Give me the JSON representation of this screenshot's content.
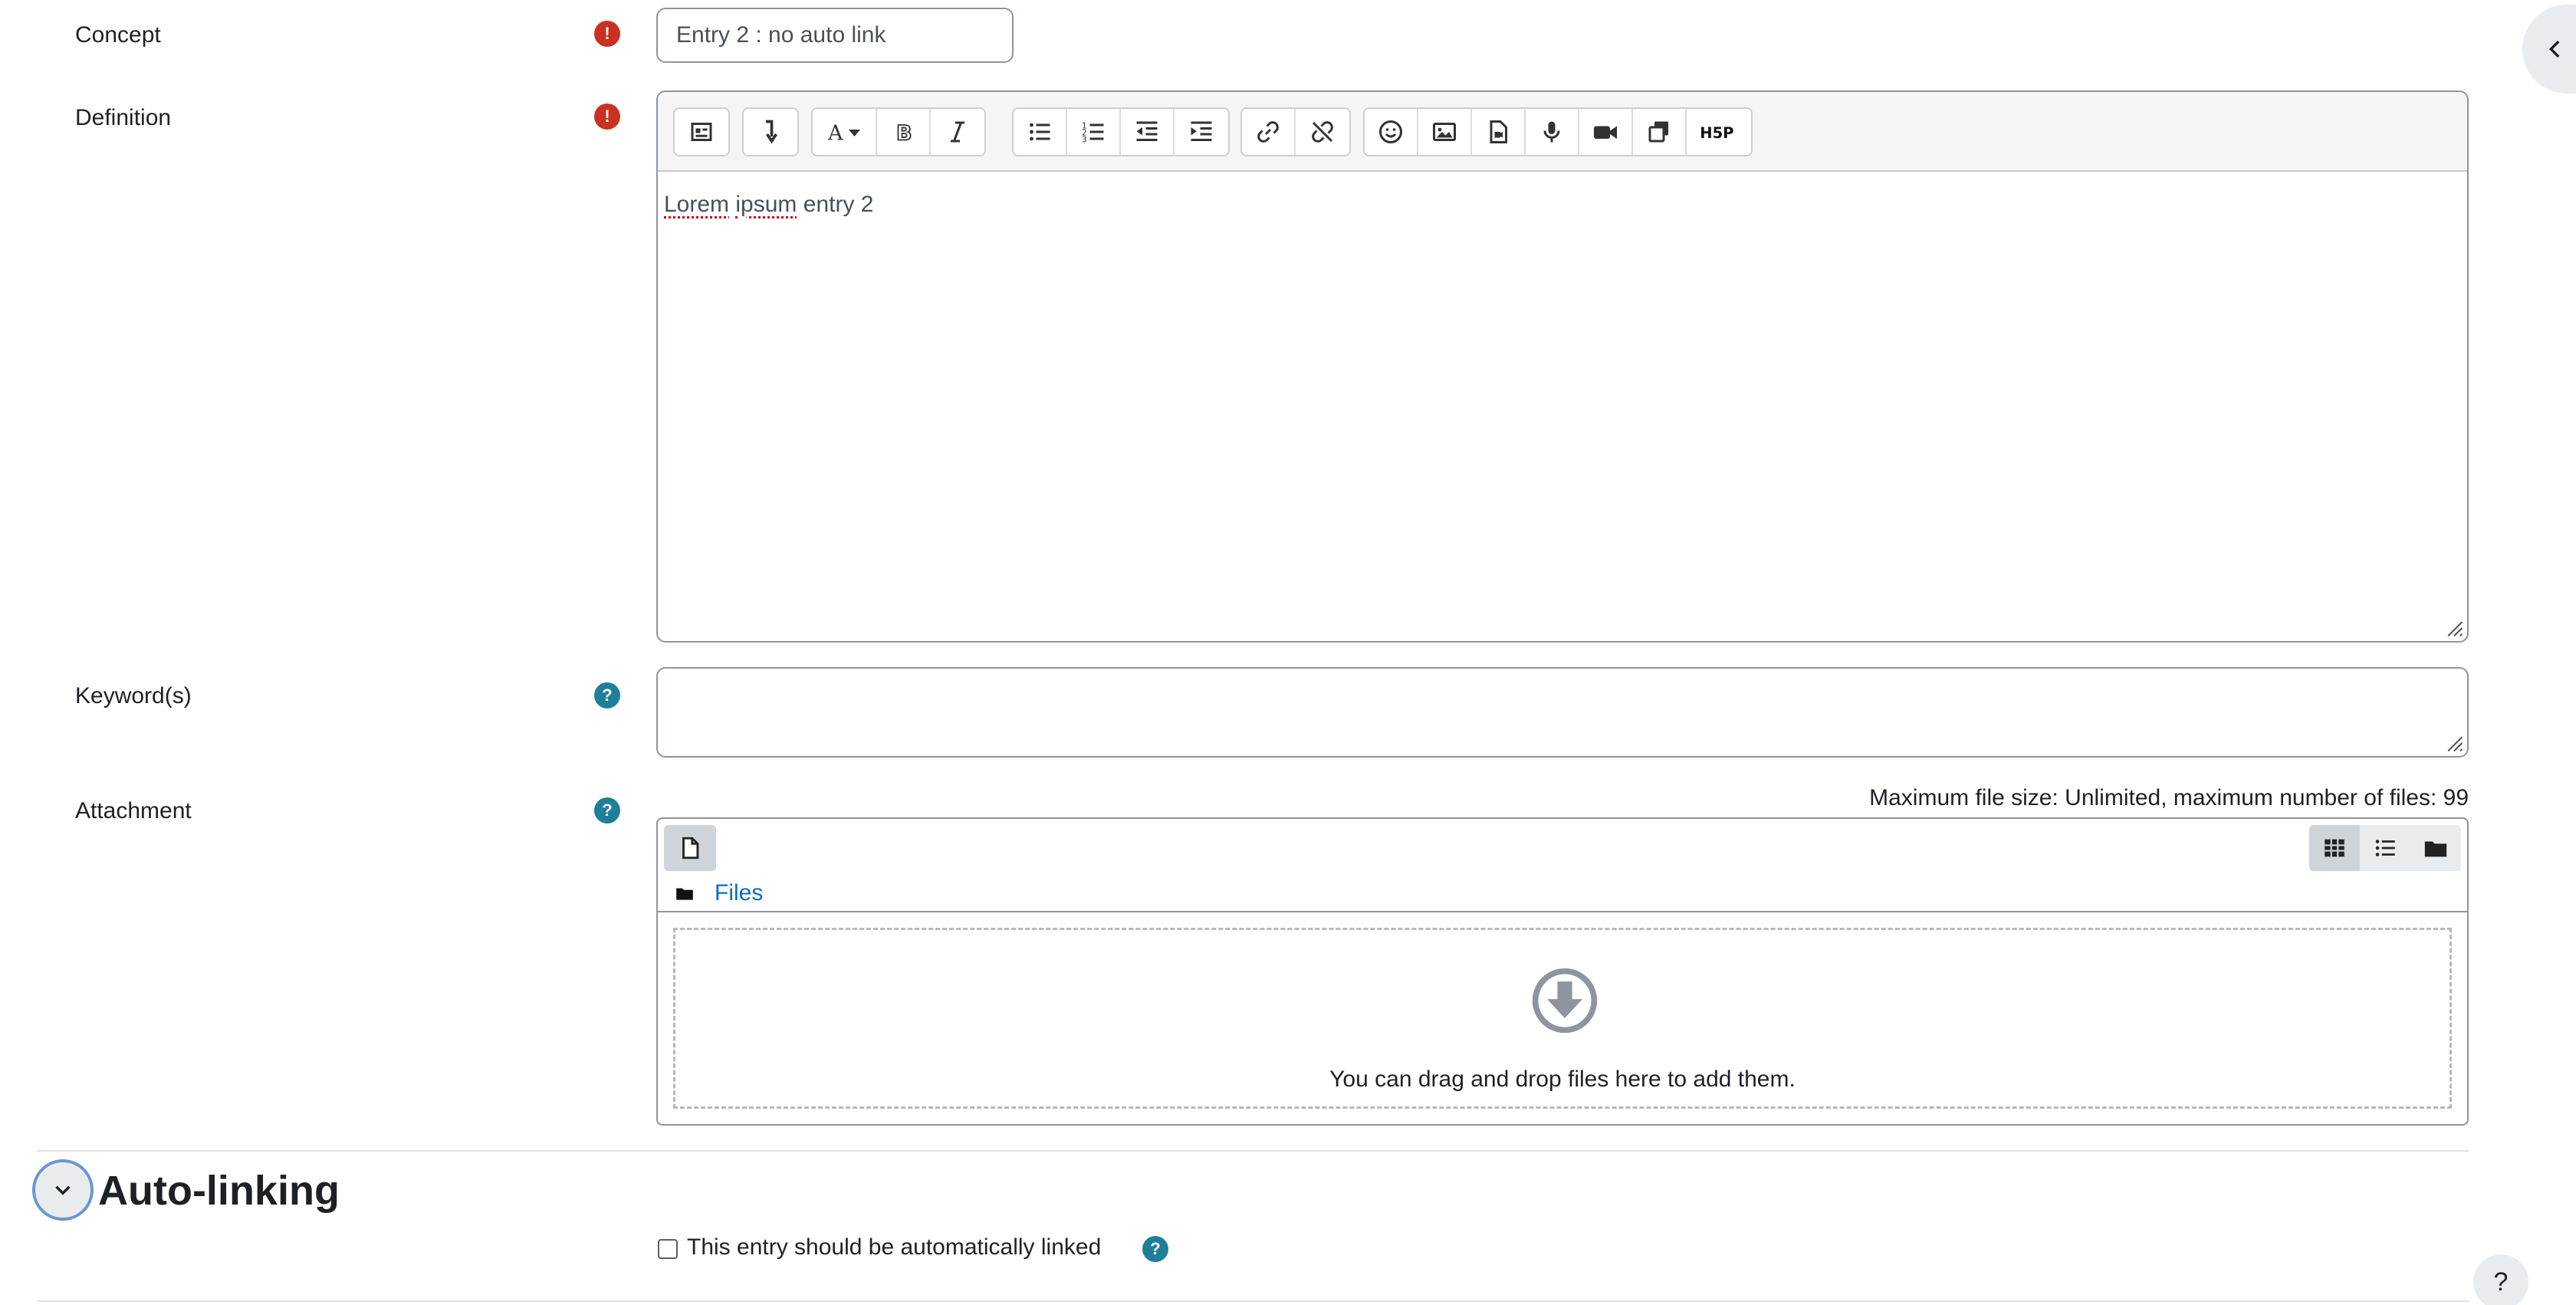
{
  "form": {
    "concept": {
      "label": "Concept",
      "value": "Entry 2 : no auto link",
      "required_icon": "exclamation-icon"
    },
    "definition": {
      "label": "Definition",
      "required_icon": "exclamation-icon",
      "content_words": [
        "Lorem",
        "ipsum",
        "entry 2"
      ],
      "toolbar_icons": [
        [
          "atto-collapse-icon",
          "paragraph-styles-icon"
        ],
        [
          "text-color-icon",
          "bold-icon",
          "italic-icon"
        ],
        [
          "unordered-list-icon",
          "ordered-list-icon",
          "outdent-icon",
          "indent-icon"
        ],
        [
          "link-icon",
          "unlink-icon"
        ],
        [
          "emoji-icon",
          "image-icon",
          "media-icon",
          "record-audio-icon",
          "record-video-icon",
          "manage-files-icon",
          "h5p-icon"
        ]
      ],
      "h5p_label": "H5P"
    },
    "keywords": {
      "label": "Keyword(s)",
      "value": "",
      "help_icon": "question-icon"
    },
    "attachment": {
      "label": "Attachment",
      "help_icon": "question-icon",
      "max_size": "Maximum file size: Unlimited, maximum number of files: 99",
      "path_link": "Files",
      "dropzone_text": "You can drag and drop files here to add them."
    }
  },
  "section": {
    "title": "Auto-linking",
    "checkbox_label": "This entry should be automatically linked",
    "checkbox_checked": false
  },
  "floating": {
    "help_label": "?"
  },
  "colors": {
    "required": "#ca3120",
    "help": "#1f7e9a",
    "link": "#0f6cbf"
  }
}
